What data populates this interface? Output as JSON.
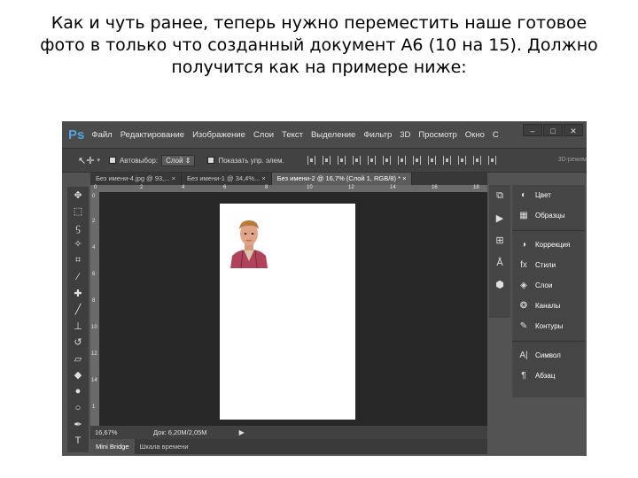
{
  "caption": {
    "line1": "Как и чуть ранее, теперь нужно переместить наше готовое",
    "line2_pre": "фото в только что созданный документ ",
    "line2_mono": "А6 (10 на 15)",
    "line2_post": ". Должно",
    "line3": "получится как на примере ниже:"
  },
  "app": {
    "logo": "Ps",
    "menu": [
      "Файл",
      "Редактирование",
      "Изображение",
      "Слои",
      "Текст",
      "Выделение",
      "Фильтр",
      "3D",
      "Просмотр",
      "Окно",
      "С"
    ],
    "window_buttons": [
      "–",
      "□",
      "✕"
    ]
  },
  "options": {
    "autoselect_label": "Автовыбор:",
    "autoselect_value": "Слой",
    "show_transform_label": "Показать упр. элем.",
    "mode_3d": "3D-режим"
  },
  "tabs": [
    {
      "label": "Без имени-4.jpg @ 93,... ×",
      "active": false
    },
    {
      "label": "Без имени-1 @ 34,4%... ×",
      "active": false
    },
    {
      "label": "Без имени-2 @ 16,7% (Слой 1, RGB/8) * ×",
      "active": true
    }
  ],
  "ruler": {
    "h_ticks": [
      "0",
      "2",
      "4",
      "6",
      "8",
      "10",
      "12",
      "14",
      "16",
      "18"
    ],
    "v_ticks": [
      "0",
      "2",
      "4",
      "6",
      "8",
      "10",
      "12",
      "14",
      "1"
    ]
  },
  "status": {
    "zoom": "16,67%",
    "doc_info": "Док: 6,20M/2,05M",
    "arrow": "▶"
  },
  "bottom_tabs": [
    "Mini Bridge",
    "Шкала времени"
  ],
  "panels": {
    "group1": [
      {
        "icon": "color-icon",
        "label": "Цвет"
      },
      {
        "icon": "swatches-icon",
        "label": "Образцы"
      }
    ],
    "group2": [
      {
        "icon": "adjustments-icon",
        "label": "Коррекция"
      },
      {
        "icon": "styles-icon",
        "label": "Стили"
      },
      {
        "icon": "layers-icon",
        "label": "Слои"
      },
      {
        "icon": "channels-icon",
        "label": "Каналы"
      },
      {
        "icon": "paths-icon",
        "label": "Контуры"
      }
    ],
    "group3": [
      {
        "icon": "character-icon",
        "label": "Символ"
      },
      {
        "icon": "paragraph-icon",
        "label": "Абзац"
      }
    ]
  }
}
